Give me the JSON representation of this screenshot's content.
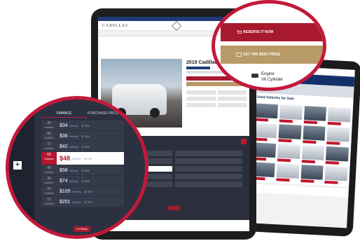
{
  "finance": {
    "tab_finance": "FINANCE",
    "tab_purchase": "PURCHASE PRICE (CASH)",
    "rows": [
      {
        "months": "36",
        "label": "months",
        "amount": "$34",
        "period": "Weekly",
        "rate": "$.74%"
      },
      {
        "months": "84",
        "label": "months",
        "amount": "$38",
        "period": "Weekly",
        "rate": "$.74%"
      },
      {
        "months": "72",
        "label": "months",
        "amount": "$42",
        "period": "Weekly",
        "rate": "$.74%"
      },
      {
        "months": "60",
        "label": "months",
        "amount": "$48",
        "period": "Weekly",
        "rate": "$.74%",
        "selected": true
      },
      {
        "months": "48",
        "label": "months",
        "amount": "$58",
        "period": "Weekly",
        "rate": "$.74%"
      },
      {
        "months": "36",
        "label": "months",
        "amount": "$74",
        "period": "Weekly",
        "rate": "$.74%"
      },
      {
        "months": "24",
        "label": "months",
        "amount": "$105",
        "period": "Weekly",
        "rate": "$.74%"
      },
      {
        "months": "12",
        "label": "months",
        "amount": "$201",
        "period": "Weekly",
        "rate": "$.74%"
      }
    ],
    "buy_now": "I'm Ready",
    "plus": "+"
  },
  "vehicle": {
    "brand": "CADILLAC",
    "title": "2019 Cadillac"
  },
  "actions": {
    "reserve": "RESERVE IT NOW",
    "best_price": "GET THE BEST PRICE",
    "engine_label": "Engine",
    "engine_value": "V6 Cylinder"
  },
  "listing": {
    "title": "Used Vehicles for Sale"
  },
  "colors": {
    "accent_red": "#c3193a",
    "gold": "#b89a66",
    "panel": "#2c3141"
  }
}
